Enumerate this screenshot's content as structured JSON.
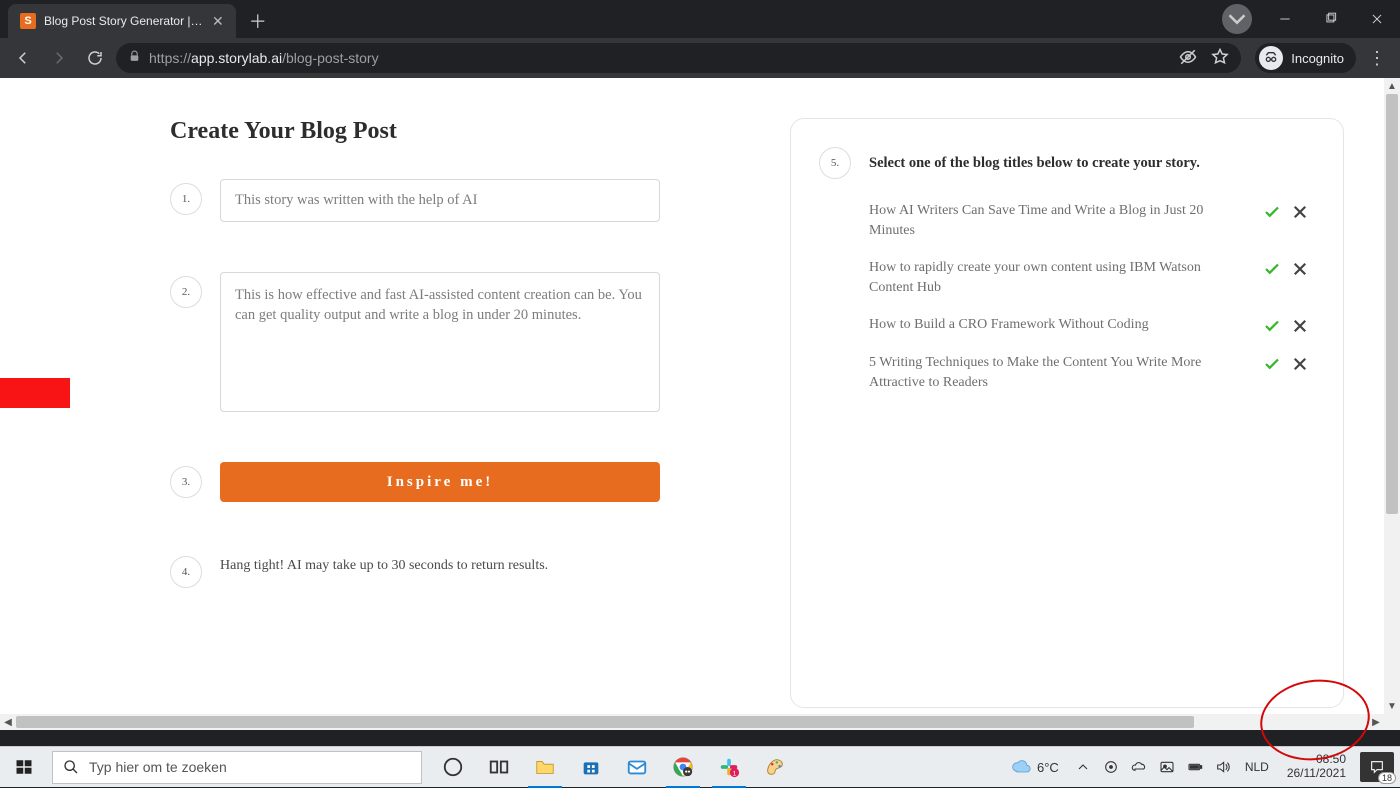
{
  "browser": {
    "tab_title": "Blog Post Story Generator | Story",
    "favicon_letter": "S",
    "url_host": "app.storylab.ai",
    "url_prefix": "https://",
    "url_path": "/blog-post-story",
    "incognito_label": "Incognito"
  },
  "page": {
    "heading": "Create Your Blog Post",
    "step1_num": "1.",
    "step1_value": "This story was written with the help of AI",
    "step2_num": "2.",
    "step2_value": "This is how effective and fast AI-assisted content creation can be. You can get quality output and write a blog in under 20 minutes.",
    "step3_num": "3.",
    "inspire_label": "Inspire me!",
    "step4_num": "4.",
    "step4_text": "Hang tight! AI may take up to 30 seconds to return results.",
    "step5_num": "5.",
    "step5_heading": "Select one of the blog titles below to create your story.",
    "titles": [
      " How AI Writers Can Save Time and Write a Blog in Just 20 Minutes",
      " How to rapidly create your own content using IBM Watson Content Hub",
      " How to Build a CRO Framework Without Coding",
      " 5 Writing Techniques to Make the Content You Write More Attractive to Readers"
    ]
  },
  "taskbar": {
    "search_placeholder": "Typ hier om te zoeken",
    "temp": "6°C",
    "lang": "NLD",
    "time": "08:50",
    "date": "26/11/2021",
    "action_badge": "18"
  }
}
